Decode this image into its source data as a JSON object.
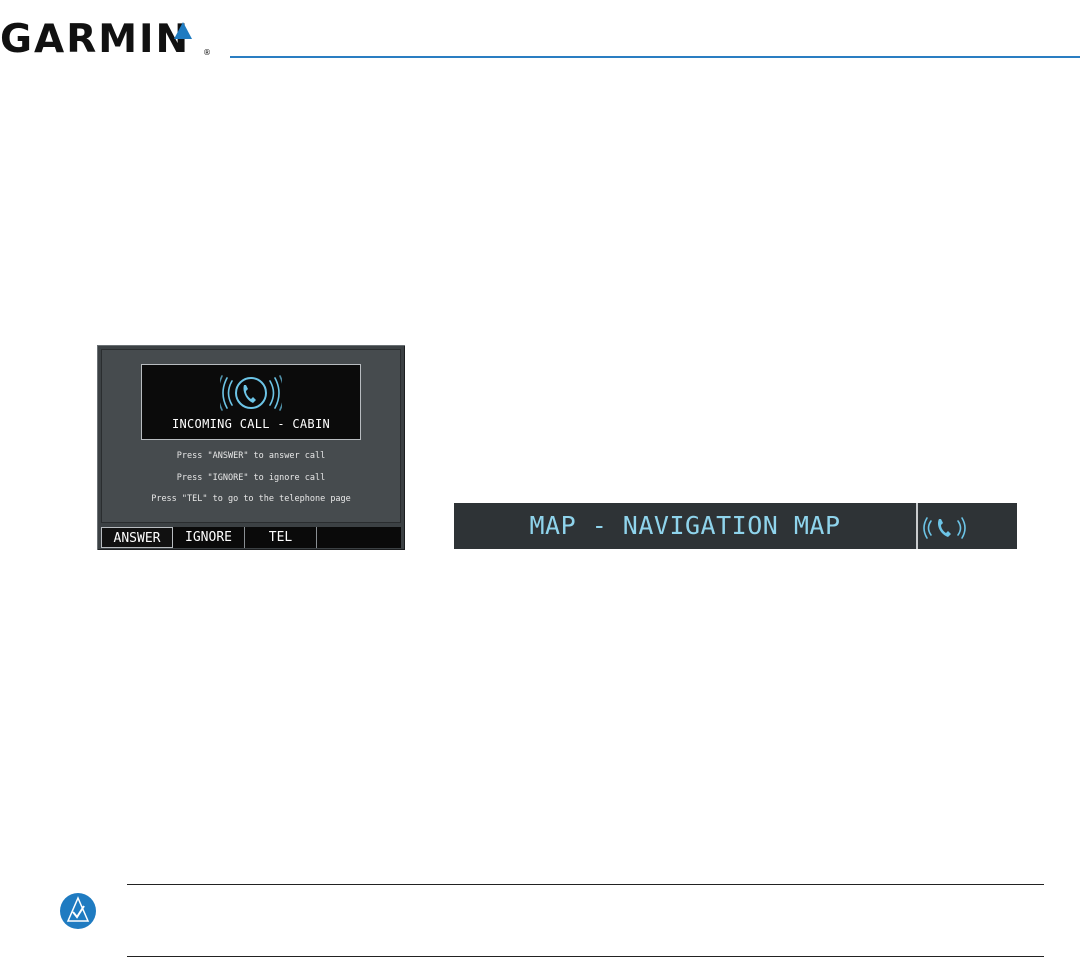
{
  "header": {
    "logo_text": "GARMIN",
    "logo_reg": "®"
  },
  "call_window": {
    "title": "INCOMING CALL - CABIN",
    "instructions": [
      "Press \"ANSWER\" to answer call",
      "Press \"IGNORE\" to ignore call",
      "Press \"TEL\" to go to the telephone page"
    ],
    "softkeys": [
      "ANSWER",
      "IGNORE",
      "TEL",
      ""
    ],
    "active_softkey": "ANSWER"
  },
  "nav_bar": {
    "title": "MAP - NAVIGATION MAP",
    "icon": "phone-ringing-icon"
  },
  "note": {
    "icon": "note-check-icon"
  },
  "colors": {
    "brand_blue": "#1f7bc1",
    "screen_cyan": "#8fd4ec",
    "window_gray": "#3c4144"
  }
}
